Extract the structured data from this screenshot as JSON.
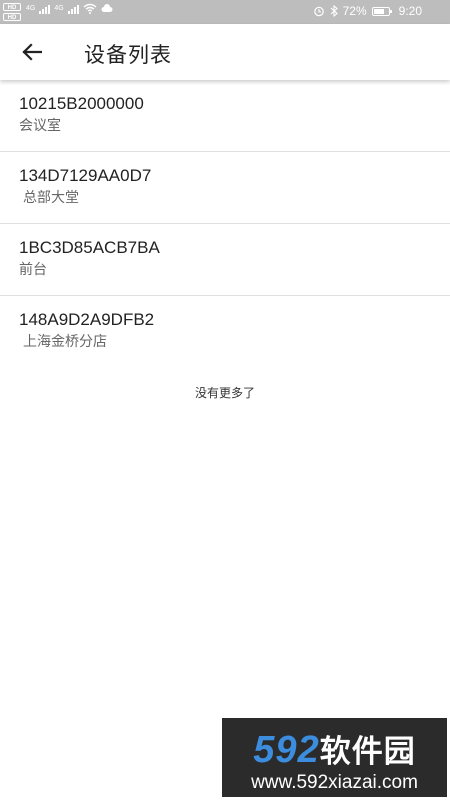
{
  "status_bar": {
    "hd_label": "HD",
    "network_1": "4G",
    "network_2": "4G",
    "battery_percent": "72%",
    "battery_level": 0.72,
    "time": "9:20",
    "icons": [
      "alarm-icon",
      "bluetooth-icon",
      "wifi-icon",
      "signal-icon",
      "battery-icon"
    ]
  },
  "app_bar": {
    "title": "设备列表",
    "back_icon": "arrow-left-icon"
  },
  "devices": [
    {
      "id": "10215B2000000",
      "name": "会议室"
    },
    {
      "id": "134D7129AA0D7",
      "name": "总部大堂"
    },
    {
      "id": "1BC3D85ACB7BA",
      "name": "前台"
    },
    {
      "id": "148A9D2A9DFB2",
      "name": "上海金桥分店"
    }
  ],
  "footer": {
    "no_more_text": "没有更多了"
  },
  "watermark": {
    "number": "592",
    "brand": "软件园",
    "url": "www.592xiazai.com"
  },
  "colors": {
    "status_bar_bg": "#bdbdbd",
    "watermark_bg": "#2b2b2b",
    "watermark_accent": "#3c8dde"
  }
}
